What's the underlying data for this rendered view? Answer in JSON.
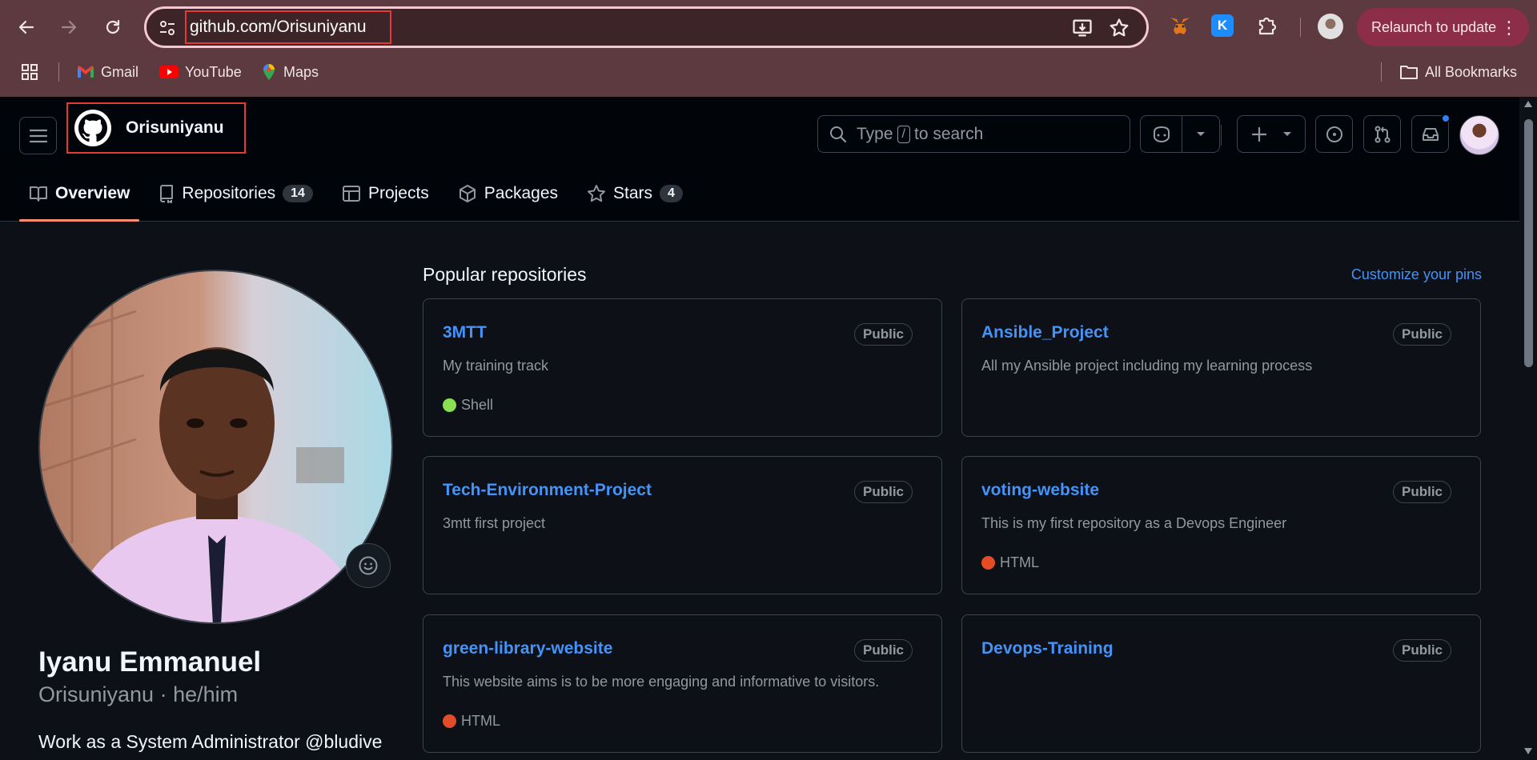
{
  "browser": {
    "url": "github.com/Orisuniyanu",
    "relaunch_label": "Relaunch to update",
    "bookmarks": [
      {
        "label": "Gmail",
        "icon": "gmail-icon"
      },
      {
        "label": "YouTube",
        "icon": "youtube-icon"
      },
      {
        "label": "Maps",
        "icon": "maps-icon"
      }
    ],
    "all_bookmarks_label": "All Bookmarks"
  },
  "header": {
    "username": "Orisuniyanu",
    "search_prefix": "Type",
    "search_key": "/",
    "search_suffix": "to search"
  },
  "tabs": [
    {
      "label": "Overview",
      "icon": "book-icon",
      "active": true
    },
    {
      "label": "Repositories",
      "icon": "repo-icon",
      "count": "14"
    },
    {
      "label": "Projects",
      "icon": "table-icon"
    },
    {
      "label": "Packages",
      "icon": "package-icon"
    },
    {
      "label": "Stars",
      "icon": "star-icon",
      "count": "4"
    }
  ],
  "profile": {
    "full_name": "Iyanu Emmanuel",
    "handle": "Orisuniyanu · he/him",
    "bio": "Work as a System Administrator @bludive"
  },
  "popular": {
    "title": "Popular repositories",
    "customize_label": "Customize your pins",
    "repos": [
      {
        "name": "3MTT",
        "visibility": "Public",
        "description": "My training track",
        "language": "Shell",
        "language_color": "#89e051"
      },
      {
        "name": "Ansible_Project",
        "visibility": "Public",
        "description": "All my Ansible project including my learning process",
        "language": "",
        "language_color": ""
      },
      {
        "name": "Tech-Environment-Project",
        "visibility": "Public",
        "description": "3mtt first project",
        "language": "",
        "language_color": ""
      },
      {
        "name": "voting-website",
        "visibility": "Public",
        "description": "This is my first repository as a Devops Engineer",
        "language": "HTML",
        "language_color": "#e34c26"
      },
      {
        "name": "green-library-website",
        "visibility": "Public",
        "description": "This website aims is to be more engaging and informative to visitors.",
        "language": "HTML",
        "language_color": "#e34c26"
      },
      {
        "name": "Devops-Training",
        "visibility": "Public",
        "description": "",
        "language": "",
        "language_color": ""
      }
    ]
  },
  "colors": {
    "chrome_bg": "#5c3a3f",
    "page_bg": "#0d1117",
    "link": "#4493f8",
    "tab_underline": "#fd8c73",
    "highlight_box": "#e53935"
  }
}
